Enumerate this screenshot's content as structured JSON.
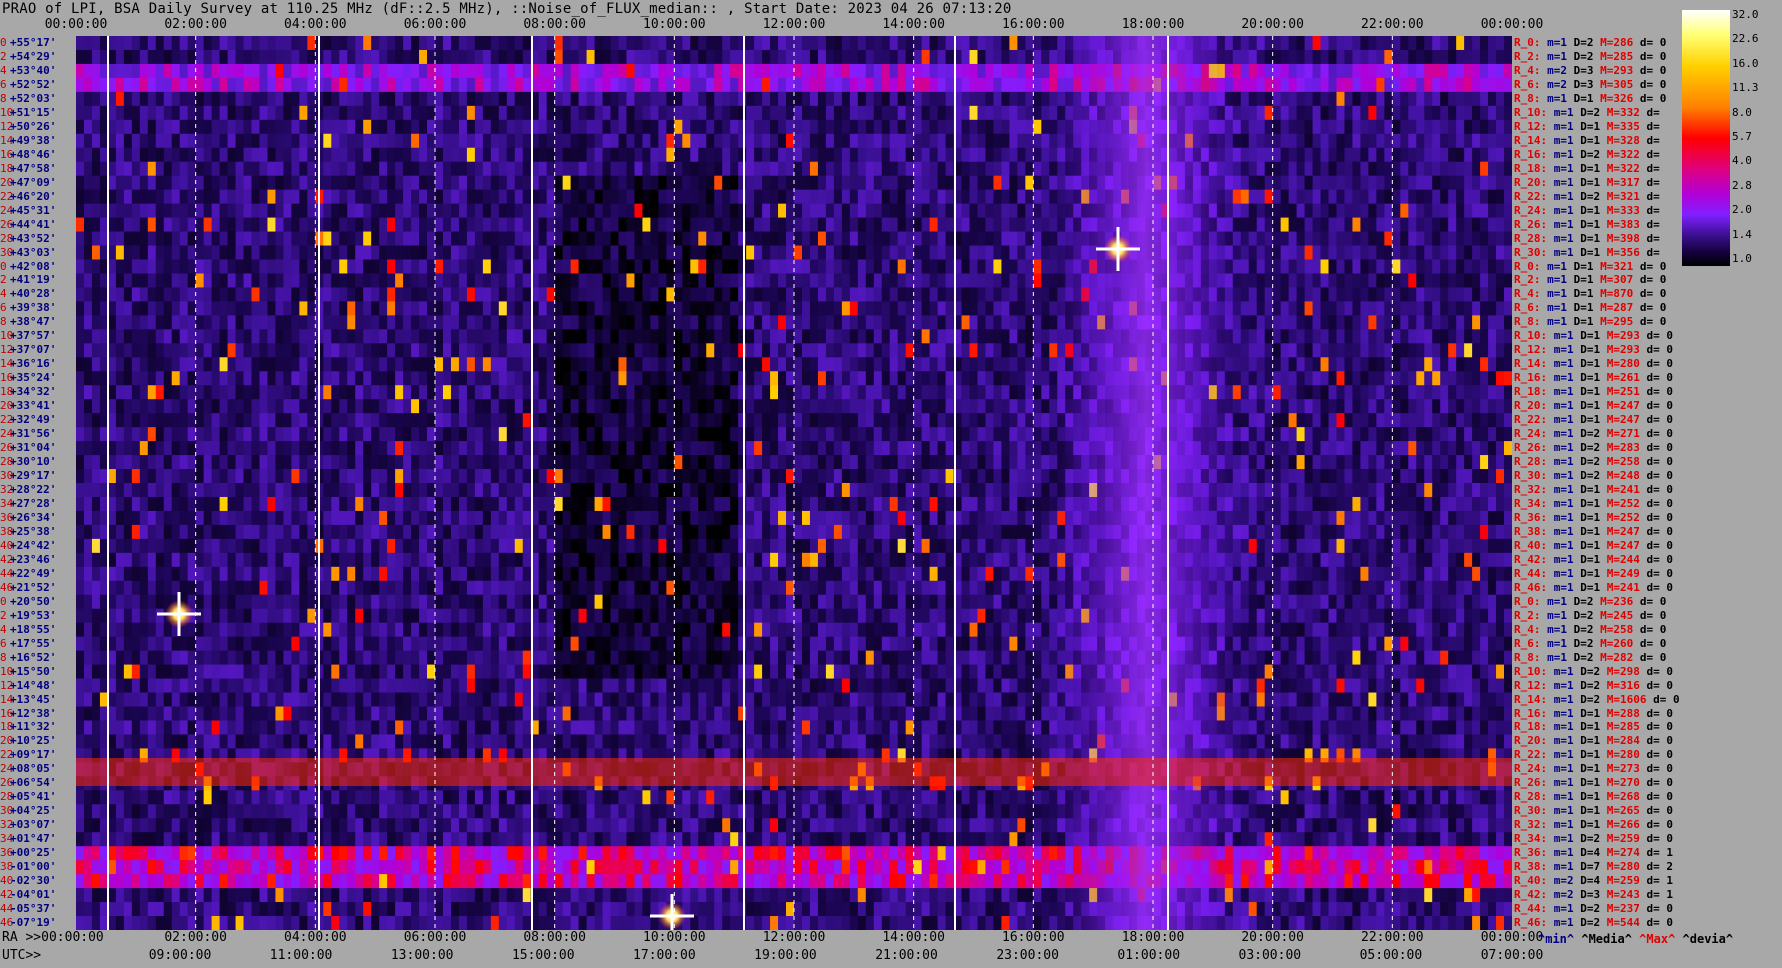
{
  "header": {
    "title": "PRAO of LPI, BSA Daily Survey at 110.25 MHz (dF::2.5 MHz), ::Noise_of_FLUX_median:: , Start Date: 2023 04 26 07:13:20"
  },
  "chart_data": {
    "type": "heatmap",
    "title": "PRAO of LPI, BSA Daily Survey at 110.25 MHz (dF::2.5 MHz), ::Noise_of_FLUX_median:: , Start Date: 2023 04 26 07:13:20",
    "x_top_ticks": [
      "00:00:00",
      "02:00:00",
      "04:00:00",
      "06:00:00",
      "08:00:00",
      "10:00:00",
      "12:00:00",
      "14:00:00",
      "16:00:00",
      "18:00:00",
      "20:00:00",
      "22:00:00",
      "00:00:00"
    ],
    "ra_prefix": "RA >>00:00:00",
    "ra_ticks": [
      "02:00:00",
      "04:00:00",
      "06:00:00",
      "08:00:00",
      "10:00:00",
      "12:00:00",
      "14:00:00",
      "16:00:00",
      "18:00:00",
      "20:00:00",
      "22:00:00",
      "00:00:00"
    ],
    "utc_prefix": "UTC>>",
    "utc_ticks": [
      "09:00:00",
      "11:00:00",
      "13:00:00",
      "15:00:00",
      "17:00:00",
      "19:00:00",
      "21:00:00",
      "23:00:00",
      "01:00:00",
      "03:00:00",
      "05:00:00",
      "07:00:00"
    ],
    "declinations": [
      "+55°17'",
      "+54°29'",
      "+53°40'",
      "+52°52'",
      "+52°03'",
      "+51°15'",
      "+50°26'",
      "+49°38'",
      "+48°46'",
      "+47°58'",
      "+47°09'",
      "+46°20'",
      "+45°31'",
      "+44°41'",
      "+43°52'",
      "+43°03'",
      "+42°08'",
      "+41°19'",
      "+40°28'",
      "+39°38'",
      "+38°47'",
      "+37°57'",
      "+37°07'",
      "+36°16'",
      "+35°24'",
      "+34°32'",
      "+33°41'",
      "+32°49'",
      "+31°56'",
      "+31°04'",
      "+30°10'",
      "+29°17'",
      "+28°22'",
      "+27°28'",
      "+26°34'",
      "+25°38'",
      "+24°42'",
      "+23°46'",
      "+22°49'",
      "+21°52'",
      "+20°50'",
      "+19°53'",
      "+18°55'",
      "+17°55'",
      "+16°52'",
      "+15°50'",
      "+14°48'",
      "+13°45'",
      "+12°38'",
      "+11°32'",
      "+10°25'",
      "+09°17'",
      "+08°05'",
      "+06°54'",
      "+05°41'",
      "+04°25'",
      "+03°07'",
      "+01°47'",
      "+00°25'",
      "-01°00'",
      "-02°30'",
      "-04°01'",
      "-05°37'",
      "-07°19'"
    ],
    "decl_indices": [
      "0",
      "2",
      "4",
      "6",
      "8",
      "10",
      "12",
      "14",
      "16",
      "18",
      "20",
      "22",
      "24",
      "26",
      "28",
      "30",
      "0",
      "2",
      "4",
      "6",
      "8",
      "10",
      "12",
      "14",
      "16",
      "18",
      "20",
      "22",
      "24",
      "26",
      "28",
      "30",
      "32",
      "34",
      "36",
      "38",
      "40",
      "42",
      "44",
      "46",
      "0",
      "2",
      "4",
      "6",
      "8",
      "10",
      "12",
      "14",
      "16",
      "18",
      "20",
      "22",
      "24",
      "26",
      "28",
      "30",
      "32",
      "34",
      "36",
      "38",
      "40",
      "42",
      "44",
      "46"
    ],
    "rows": [
      {
        "r": "R_0:",
        "m": "m=1",
        "d": "D=2",
        "M": "M=286",
        "dd": "d= 0"
      },
      {
        "r": "R_2:",
        "m": "m=1",
        "d": "D=2",
        "M": "M=285",
        "dd": "d= 0"
      },
      {
        "r": "R_4:",
        "m": "m=2",
        "d": "D=3",
        "M": "M=293",
        "dd": "d= 0"
      },
      {
        "r": "R_6:",
        "m": "m=2",
        "d": "D=3",
        "M": "M=305",
        "dd": "d= 0"
      },
      {
        "r": "R_8:",
        "m": "m=1",
        "d": "D=1",
        "M": "M=326",
        "dd": "d= 0"
      },
      {
        "r": "R_10:",
        "m": "m=1",
        "d": "D=2",
        "M": "M=332",
        "dd": "d="
      },
      {
        "r": "R_12:",
        "m": "m=1",
        "d": "D=1",
        "M": "M=335",
        "dd": "d="
      },
      {
        "r": "R_14:",
        "m": "m=1",
        "d": "D=1",
        "M": "M=328",
        "dd": "d="
      },
      {
        "r": "R_16:",
        "m": "m=1",
        "d": "D=2",
        "M": "M=322",
        "dd": "d="
      },
      {
        "r": "R_18:",
        "m": "m=1",
        "d": "D=1",
        "M": "M=322",
        "dd": "d="
      },
      {
        "r": "R_20:",
        "m": "m=1",
        "d": "D=1",
        "M": "M=317",
        "dd": "d="
      },
      {
        "r": "R_22:",
        "m": "m=1",
        "d": "D=2",
        "M": "M=321",
        "dd": "d="
      },
      {
        "r": "R_24:",
        "m": "m=1",
        "d": "D=1",
        "M": "M=333",
        "dd": "d="
      },
      {
        "r": "R_26:",
        "m": "m=1",
        "d": "D=1",
        "M": "M=383",
        "dd": "d="
      },
      {
        "r": "R_28:",
        "m": "m=1",
        "d": "D=1",
        "M": "M=398",
        "dd": "d="
      },
      {
        "r": "R_30:",
        "m": "m=1",
        "d": "D=1",
        "M": "M=356",
        "dd": "d="
      },
      {
        "r": "R_0:",
        "m": "m=1",
        "d": "D=1",
        "M": "M=321",
        "dd": "d= 0"
      },
      {
        "r": "R_2:",
        "m": "m=1",
        "d": "D=1",
        "M": "M=307",
        "dd": "d= 0"
      },
      {
        "r": "R_4:",
        "m": "m=1",
        "d": "D=1",
        "M": "M=870",
        "dd": "d= 0"
      },
      {
        "r": "R_6:",
        "m": "m=1",
        "d": "D=1",
        "M": "M=287",
        "dd": "d= 0"
      },
      {
        "r": "R_8:",
        "m": "m=1",
        "d": "D=1",
        "M": "M=295",
        "dd": "d= 0"
      },
      {
        "r": "R_10:",
        "m": "m=1",
        "d": "D=1",
        "M": "M=293",
        "dd": "d= 0"
      },
      {
        "r": "R_12:",
        "m": "m=1",
        "d": "D=1",
        "M": "M=293",
        "dd": "d= 0"
      },
      {
        "r": "R_14:",
        "m": "m=1",
        "d": "D=1",
        "M": "M=280",
        "dd": "d= 0"
      },
      {
        "r": "R_16:",
        "m": "m=1",
        "d": "D=1",
        "M": "M=261",
        "dd": "d= 0"
      },
      {
        "r": "R_18:",
        "m": "m=1",
        "d": "D=1",
        "M": "M=251",
        "dd": "d= 0"
      },
      {
        "r": "R_20:",
        "m": "m=1",
        "d": "D=1",
        "M": "M=247",
        "dd": "d= 0"
      },
      {
        "r": "R_22:",
        "m": "m=1",
        "d": "D=1",
        "M": "M=247",
        "dd": "d= 0"
      },
      {
        "r": "R_24:",
        "m": "m=1",
        "d": "D=2",
        "M": "M=271",
        "dd": "d= 0"
      },
      {
        "r": "R_26:",
        "m": "m=1",
        "d": "D=2",
        "M": "M=283",
        "dd": "d= 0"
      },
      {
        "r": "R_28:",
        "m": "m=1",
        "d": "D=2",
        "M": "M=258",
        "dd": "d= 0"
      },
      {
        "r": "R_30:",
        "m": "m=1",
        "d": "D=2",
        "M": "M=248",
        "dd": "d= 0"
      },
      {
        "r": "R_32:",
        "m": "m=1",
        "d": "D=1",
        "M": "M=241",
        "dd": "d= 0"
      },
      {
        "r": "R_34:",
        "m": "m=1",
        "d": "D=1",
        "M": "M=252",
        "dd": "d= 0"
      },
      {
        "r": "R_36:",
        "m": "m=1",
        "d": "D=1",
        "M": "M=252",
        "dd": "d= 0"
      },
      {
        "r": "R_38:",
        "m": "m=1",
        "d": "D=1",
        "M": "M=247",
        "dd": "d= 0"
      },
      {
        "r": "R_40:",
        "m": "m=1",
        "d": "D=1",
        "M": "M=247",
        "dd": "d= 0"
      },
      {
        "r": "R_42:",
        "m": "m=1",
        "d": "D=1",
        "M": "M=244",
        "dd": "d= 0"
      },
      {
        "r": "R_44:",
        "m": "m=1",
        "d": "D=1",
        "M": "M=249",
        "dd": "d= 0"
      },
      {
        "r": "R_46:",
        "m": "m=1",
        "d": "D=1",
        "M": "M=241",
        "dd": "d= 0"
      },
      {
        "r": "R_0:",
        "m": "m=1",
        "d": "D=2",
        "M": "M=236",
        "dd": "d= 0"
      },
      {
        "r": "R_2:",
        "m": "m=1",
        "d": "D=2",
        "M": "M=245",
        "dd": "d= 0"
      },
      {
        "r": "R_4:",
        "m": "m=1",
        "d": "D=2",
        "M": "M=258",
        "dd": "d= 0"
      },
      {
        "r": "R_6:",
        "m": "m=1",
        "d": "D=2",
        "M": "M=260",
        "dd": "d= 0"
      },
      {
        "r": "R_8:",
        "m": "m=1",
        "d": "D=2",
        "M": "M=282",
        "dd": "d= 0"
      },
      {
        "r": "R_10:",
        "m": "m=1",
        "d": "D=2",
        "M": "M=298",
        "dd": "d= 0"
      },
      {
        "r": "R_12:",
        "m": "m=1",
        "d": "D=2",
        "M": "M=316",
        "dd": "d= 0"
      },
      {
        "r": "R_14:",
        "m": "m=1",
        "d": "D=2",
        "M": "M=1606",
        "dd": "d= 0"
      },
      {
        "r": "R_16:",
        "m": "m=1",
        "d": "D=1",
        "M": "M=288",
        "dd": "d= 0"
      },
      {
        "r": "R_18:",
        "m": "m=1",
        "d": "D=1",
        "M": "M=285",
        "dd": "d= 0"
      },
      {
        "r": "R_20:",
        "m": "m=1",
        "d": "D=1",
        "M": "M=284",
        "dd": "d= 0"
      },
      {
        "r": "R_22:",
        "m": "m=1",
        "d": "D=1",
        "M": "M=280",
        "dd": "d= 0"
      },
      {
        "r": "R_24:",
        "m": "m=1",
        "d": "D=1",
        "M": "M=273",
        "dd": "d= 0"
      },
      {
        "r": "R_26:",
        "m": "m=1",
        "d": "D=1",
        "M": "M=270",
        "dd": "d= 0"
      },
      {
        "r": "R_28:",
        "m": "m=1",
        "d": "D=1",
        "M": "M=268",
        "dd": "d= 0"
      },
      {
        "r": "R_30:",
        "m": "m=1",
        "d": "D=1",
        "M": "M=265",
        "dd": "d= 0"
      },
      {
        "r": "R_32:",
        "m": "m=1",
        "d": "D=1",
        "M": "M=266",
        "dd": "d= 0"
      },
      {
        "r": "R_34:",
        "m": "m=1",
        "d": "D=2",
        "M": "M=259",
        "dd": "d= 0"
      },
      {
        "r": "R_36:",
        "m": "m=1",
        "d": "D=4",
        "M": "M=274",
        "dd": "d= 1"
      },
      {
        "r": "R_38:",
        "m": "m=1",
        "d": "D=7",
        "M": "M=280",
        "dd": "d= 2"
      },
      {
        "r": "R_40:",
        "m": "m=2",
        "d": "D=4",
        "M": "M=259",
        "dd": "d= 1"
      },
      {
        "r": "R_42:",
        "m": "m=2",
        "d": "D=3",
        "M": "M=243",
        "dd": "d= 1"
      },
      {
        "r": "R_44:",
        "m": "m=1",
        "d": "D=2",
        "M": "M=237",
        "dd": "d= 0"
      },
      {
        "r": "R_46:",
        "m": "m=1",
        "d": "D=2",
        "M": "M=544",
        "dd": "d= 0"
      }
    ],
    "colorbar_labels": [
      "32.0",
      "22.6",
      "16.0",
      "11.3",
      "8.0",
      "5.7",
      "4.0",
      "2.8",
      "2.0",
      "1.4",
      "1.0"
    ],
    "legend": {
      "min": "^min^",
      "media": "^Media^",
      "max": "^Max^",
      "devia": "^devia^"
    },
    "bright_sources": [
      {
        "ra": "01:50:00",
        "dec": "+13°45'"
      },
      {
        "ra": "19:50:00",
        "dec": "+41°19'"
      },
      {
        "ra": "11:40:00",
        "dec": "-07°19'"
      }
    ],
    "colors": {
      "background": "#a8a8a8",
      "low": "#000000",
      "mid": "#8020ff",
      "high": "#ff0000",
      "max": "#ffffff"
    }
  }
}
